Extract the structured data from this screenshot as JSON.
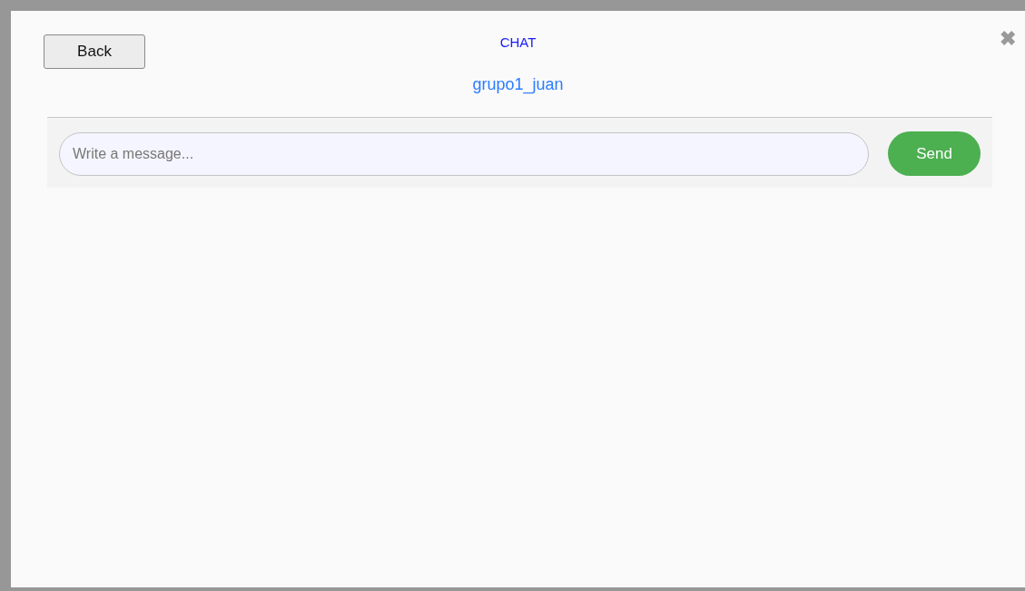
{
  "modal": {
    "back_button": "Back",
    "title": "CHAT",
    "chat_name": "grupo1_juan",
    "close": "✖",
    "message_field": {
      "placeholder": "Write a message..."
    },
    "send_button": "Send"
  }
}
